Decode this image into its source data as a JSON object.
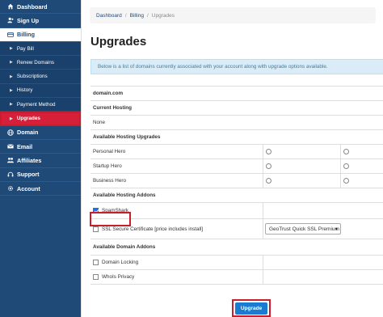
{
  "sidebar": {
    "items": [
      {
        "label": "Dashboard",
        "icon": "home-icon"
      },
      {
        "label": "Sign Up",
        "icon": "signup-icon"
      },
      {
        "label": "Billing",
        "icon": "billing-icon"
      }
    ],
    "billing_sub": [
      {
        "label": "Pay Bill"
      },
      {
        "label": "Renew Domains"
      },
      {
        "label": "Subscriptions"
      },
      {
        "label": "History"
      },
      {
        "label": "Payment Method"
      },
      {
        "label": "Upgrades"
      }
    ],
    "items_after": [
      {
        "label": "Domain",
        "icon": "globe-icon"
      },
      {
        "label": "Email",
        "icon": "email-icon"
      },
      {
        "label": "Affiliates",
        "icon": "affiliates-icon"
      },
      {
        "label": "Support",
        "icon": "support-icon"
      },
      {
        "label": "Account",
        "icon": "account-icon"
      }
    ]
  },
  "breadcrumb": {
    "home": "Dashboard",
    "section": "Billing",
    "current": "Upgrades"
  },
  "page": {
    "title": "Upgrades",
    "info": "Below is a list of domains currently associated with your account along with upgrade options available."
  },
  "table": {
    "domain": "domain.com",
    "current_hosting_label": "Current Hosting",
    "current_hosting_value": "None",
    "available_hosting_label": "Available Hosting Upgrades",
    "hosting_options": [
      "Personal Hero",
      "Startup Hero",
      "Business Hero"
    ],
    "addons_label": "Available Hosting Addons",
    "spamshark": "SpamShark",
    "ssl": "SSL Secure Certificate [price includes install]",
    "ssl_select": "GeoTrust Quick SSL Premium",
    "domain_addons_label": "Available Domain Addons",
    "domain_locking": "Domain Locking",
    "whois": "WhoIs Privacy"
  },
  "actions": {
    "upgrade": "Upgrade"
  },
  "colors": {
    "sidebar": "#1f4a78",
    "active": "#d6203a",
    "button": "#1a7bd0",
    "highlight": "#c91c2c"
  }
}
